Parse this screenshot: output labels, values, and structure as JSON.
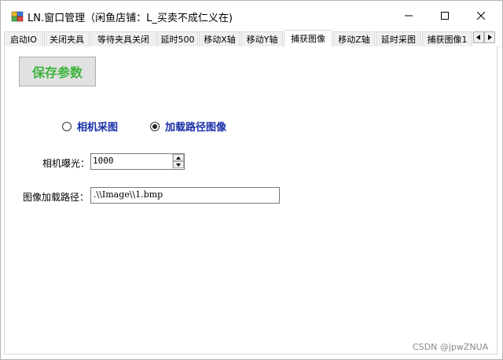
{
  "window": {
    "title": "LN.窗口管理（闲鱼店铺：L_买卖不成仁义在)",
    "minimize_icon": "minimize-icon",
    "maximize_icon": "maximize-icon",
    "close_icon": "close-icon"
  },
  "tabs": [
    {
      "label": "启动IO",
      "active": false
    },
    {
      "label": "关闭夹具",
      "active": false
    },
    {
      "label": "等待夹具关闭",
      "active": false
    },
    {
      "label": "延时500",
      "active": false
    },
    {
      "label": "移动X轴",
      "active": false
    },
    {
      "label": "移动Y轴",
      "active": false
    },
    {
      "label": "捕获图像",
      "active": true
    },
    {
      "label": "移动Z轴",
      "active": false
    },
    {
      "label": "延时采图",
      "active": false
    },
    {
      "label": "捕获图像1",
      "active": false
    }
  ],
  "page": {
    "save_label": "保存参数",
    "radio_camera": "相机采图",
    "radio_load": "加载路径图像",
    "selected_radio": "加载路径图像",
    "exposure_label": "相机曝光：",
    "exposure_value": "1000",
    "path_label": "图像加载路径：",
    "path_value": ".\\\\Image\\\\1.bmp"
  },
  "watermark": "CSDN @jpwZNUA",
  "colors": {
    "save_text": "#3cb33c",
    "radio_text": "#1a2fa8"
  }
}
